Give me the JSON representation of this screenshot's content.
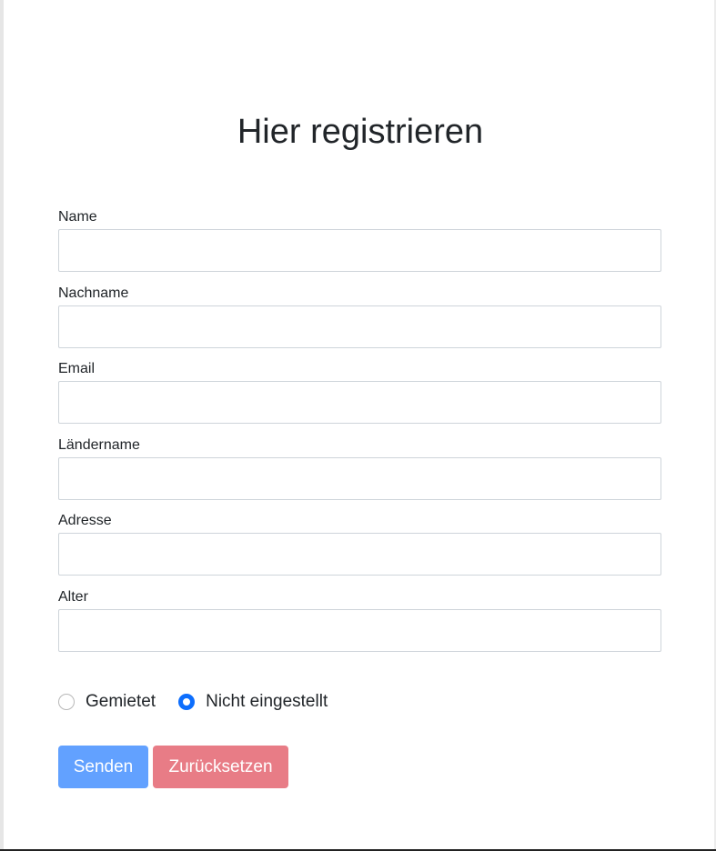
{
  "title": "Hier registrieren",
  "fields": [
    {
      "label": "Name",
      "value": ""
    },
    {
      "label": "Nachname",
      "value": ""
    },
    {
      "label": "Email",
      "value": ""
    },
    {
      "label": "Ländername",
      "value": ""
    },
    {
      "label": "Adresse",
      "value": ""
    },
    {
      "label": "Alter",
      "value": ""
    }
  ],
  "radios": [
    {
      "label": "Gemietet",
      "checked": false
    },
    {
      "label": "Nicht eingestellt",
      "checked": true
    }
  ],
  "buttons": {
    "submit": "Senden",
    "reset": "Zurücksetzen"
  },
  "colors": {
    "accent": "#0d6efd",
    "submit_bg": "#62a1ff",
    "reset_bg": "#e87c86"
  }
}
